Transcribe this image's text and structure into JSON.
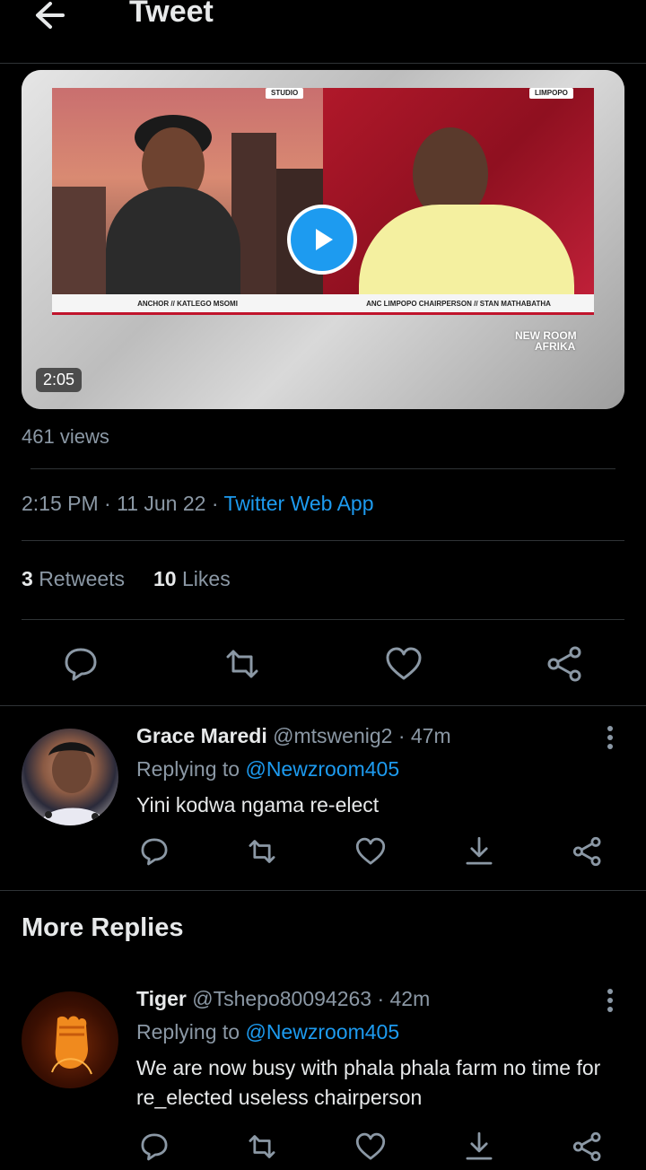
{
  "header": {
    "title": "Tweet"
  },
  "media": {
    "duration": "2:05",
    "loc_left": "STUDIO",
    "loc_right": "LIMPOPO",
    "lower_left": "ANCHOR // KATLEGO MSOMI",
    "lower_right": "ANC LIMPOPO CHAIRPERSON // STAN MATHABATHA",
    "brand_line1": "NEW ROOM",
    "brand_line2": "AFRIKA"
  },
  "tweet": {
    "views": "461 views",
    "time": "2:15 PM",
    "date": "11 Jun 22",
    "via": "Twitter Web App",
    "retweets_count": "3",
    "retweets_label": "Retweets",
    "likes_count": "10",
    "likes_label": "Likes"
  },
  "replies": [
    {
      "name": "Grace Maredi",
      "handle": "@mtswenig2",
      "time": "· 47m",
      "replying_label": "Replying to",
      "mention": "@Newzroom405",
      "text": "Yini kodwa ngama re-elect"
    },
    {
      "name": "Tiger",
      "handle": "@Tshepo80094263",
      "time": "· 42m",
      "replying_label": "Replying to",
      "mention": "@Newzroom405",
      "text": "We are now busy with phala phala farm no time for re_elected useless chairperson"
    }
  ],
  "more_replies_title": "More Replies",
  "colors": {
    "accent": "#1d9bf0",
    "muted": "#8b98a5",
    "background": "#000000"
  },
  "icons": [
    "back-arrow-icon",
    "play-icon",
    "reply-icon",
    "retweet-icon",
    "like-icon",
    "share-icon",
    "download-icon",
    "more-icon"
  ]
}
